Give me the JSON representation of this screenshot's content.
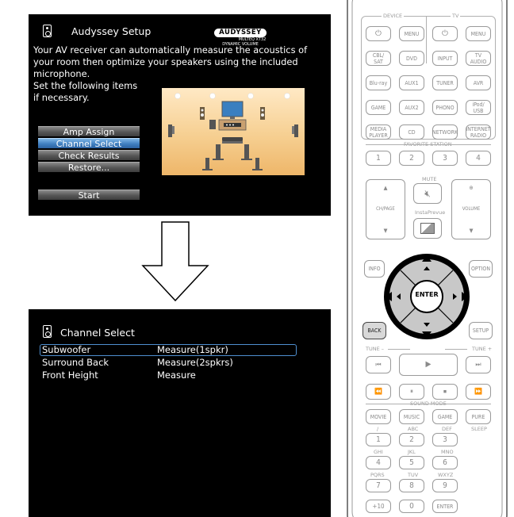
{
  "top_screen": {
    "title": "Audyssey Setup",
    "logo": {
      "brand": "AUDYSSEY",
      "sub1": "MULTEQ XT32",
      "sub2": "DYNAMIC VOLUME"
    },
    "description": [
      "Your AV receiver can automatically measure the acoustics of",
      "your room then optimize your speakers using the included",
      "microphone.",
      "Set the following items",
      "if necessary."
    ],
    "menu": [
      {
        "label": "Amp Assign",
        "selected": false
      },
      {
        "label": "Channel Select",
        "selected": true
      },
      {
        "label": "Check Results",
        "selected": false
      },
      {
        "label": "Restore...",
        "selected": false
      }
    ],
    "start_label": "Start"
  },
  "bottom_screen": {
    "title": "Channel Select",
    "rows": [
      {
        "name": "Subwoofer",
        "value": "Measure(1spkr)"
      },
      {
        "name": "Surround Back",
        "value": "Measure(2spkrs)"
      },
      {
        "name": "Front Height",
        "value": "Measure"
      }
    ]
  },
  "remote": {
    "section_labels": {
      "device": "DEVICE",
      "tv": "TV",
      "favorite": "FAVORITE STATION",
      "mute": "MUTE",
      "ch_page": "CH/PAGE",
      "volume": "VOLUME",
      "insta": "InstaPrevue",
      "tune_minus": "TUNE –",
      "tune_plus": "TUNE +",
      "sound_mode": "SOUND MODE"
    },
    "power_row": [
      "⏻",
      "MENU",
      "⏻",
      "MENU"
    ],
    "source_rows": [
      [
        "CBL/\nSAT",
        "DVD",
        "INPUT",
        "TV\nAUDIO"
      ],
      [
        "Blu-ray",
        "AUX1",
        "TUNER",
        "AVR"
      ],
      [
        "GAME",
        "AUX2",
        "PHONO",
        "iPod/\nUSB"
      ],
      [
        "MEDIA\nPLAYER",
        "CD",
        "NETWORK",
        "INTERNET\nRADIO"
      ]
    ],
    "favorites": [
      "1",
      "2",
      "3",
      "4"
    ],
    "info": "INFO",
    "option": "OPTION",
    "enter": "ENTER",
    "back": "BACK",
    "setup": "SETUP",
    "transport": [
      "⏮",
      "▶",
      "⏭"
    ],
    "transport2": [
      "⏪",
      "⏸",
      "⏹",
      "⏩"
    ],
    "sound_modes": [
      "MOVIE",
      "MUSIC",
      "GAME",
      "PURE"
    ],
    "num_labels_top": [
      "/",
      "ABC",
      "DEF",
      "SLEEP"
    ],
    "num_row1": [
      "1",
      "2",
      "3"
    ],
    "num_labels_mid": [
      "GHI",
      "JKL",
      "MNO"
    ],
    "num_row2": [
      "4",
      "5",
      "6"
    ],
    "num_labels_low": [
      "PQRS",
      "TUV",
      "WXYZ"
    ],
    "num_row3": [
      "7",
      "8",
      "9"
    ],
    "num_row4": [
      "+10",
      "0",
      "ENTER"
    ]
  }
}
